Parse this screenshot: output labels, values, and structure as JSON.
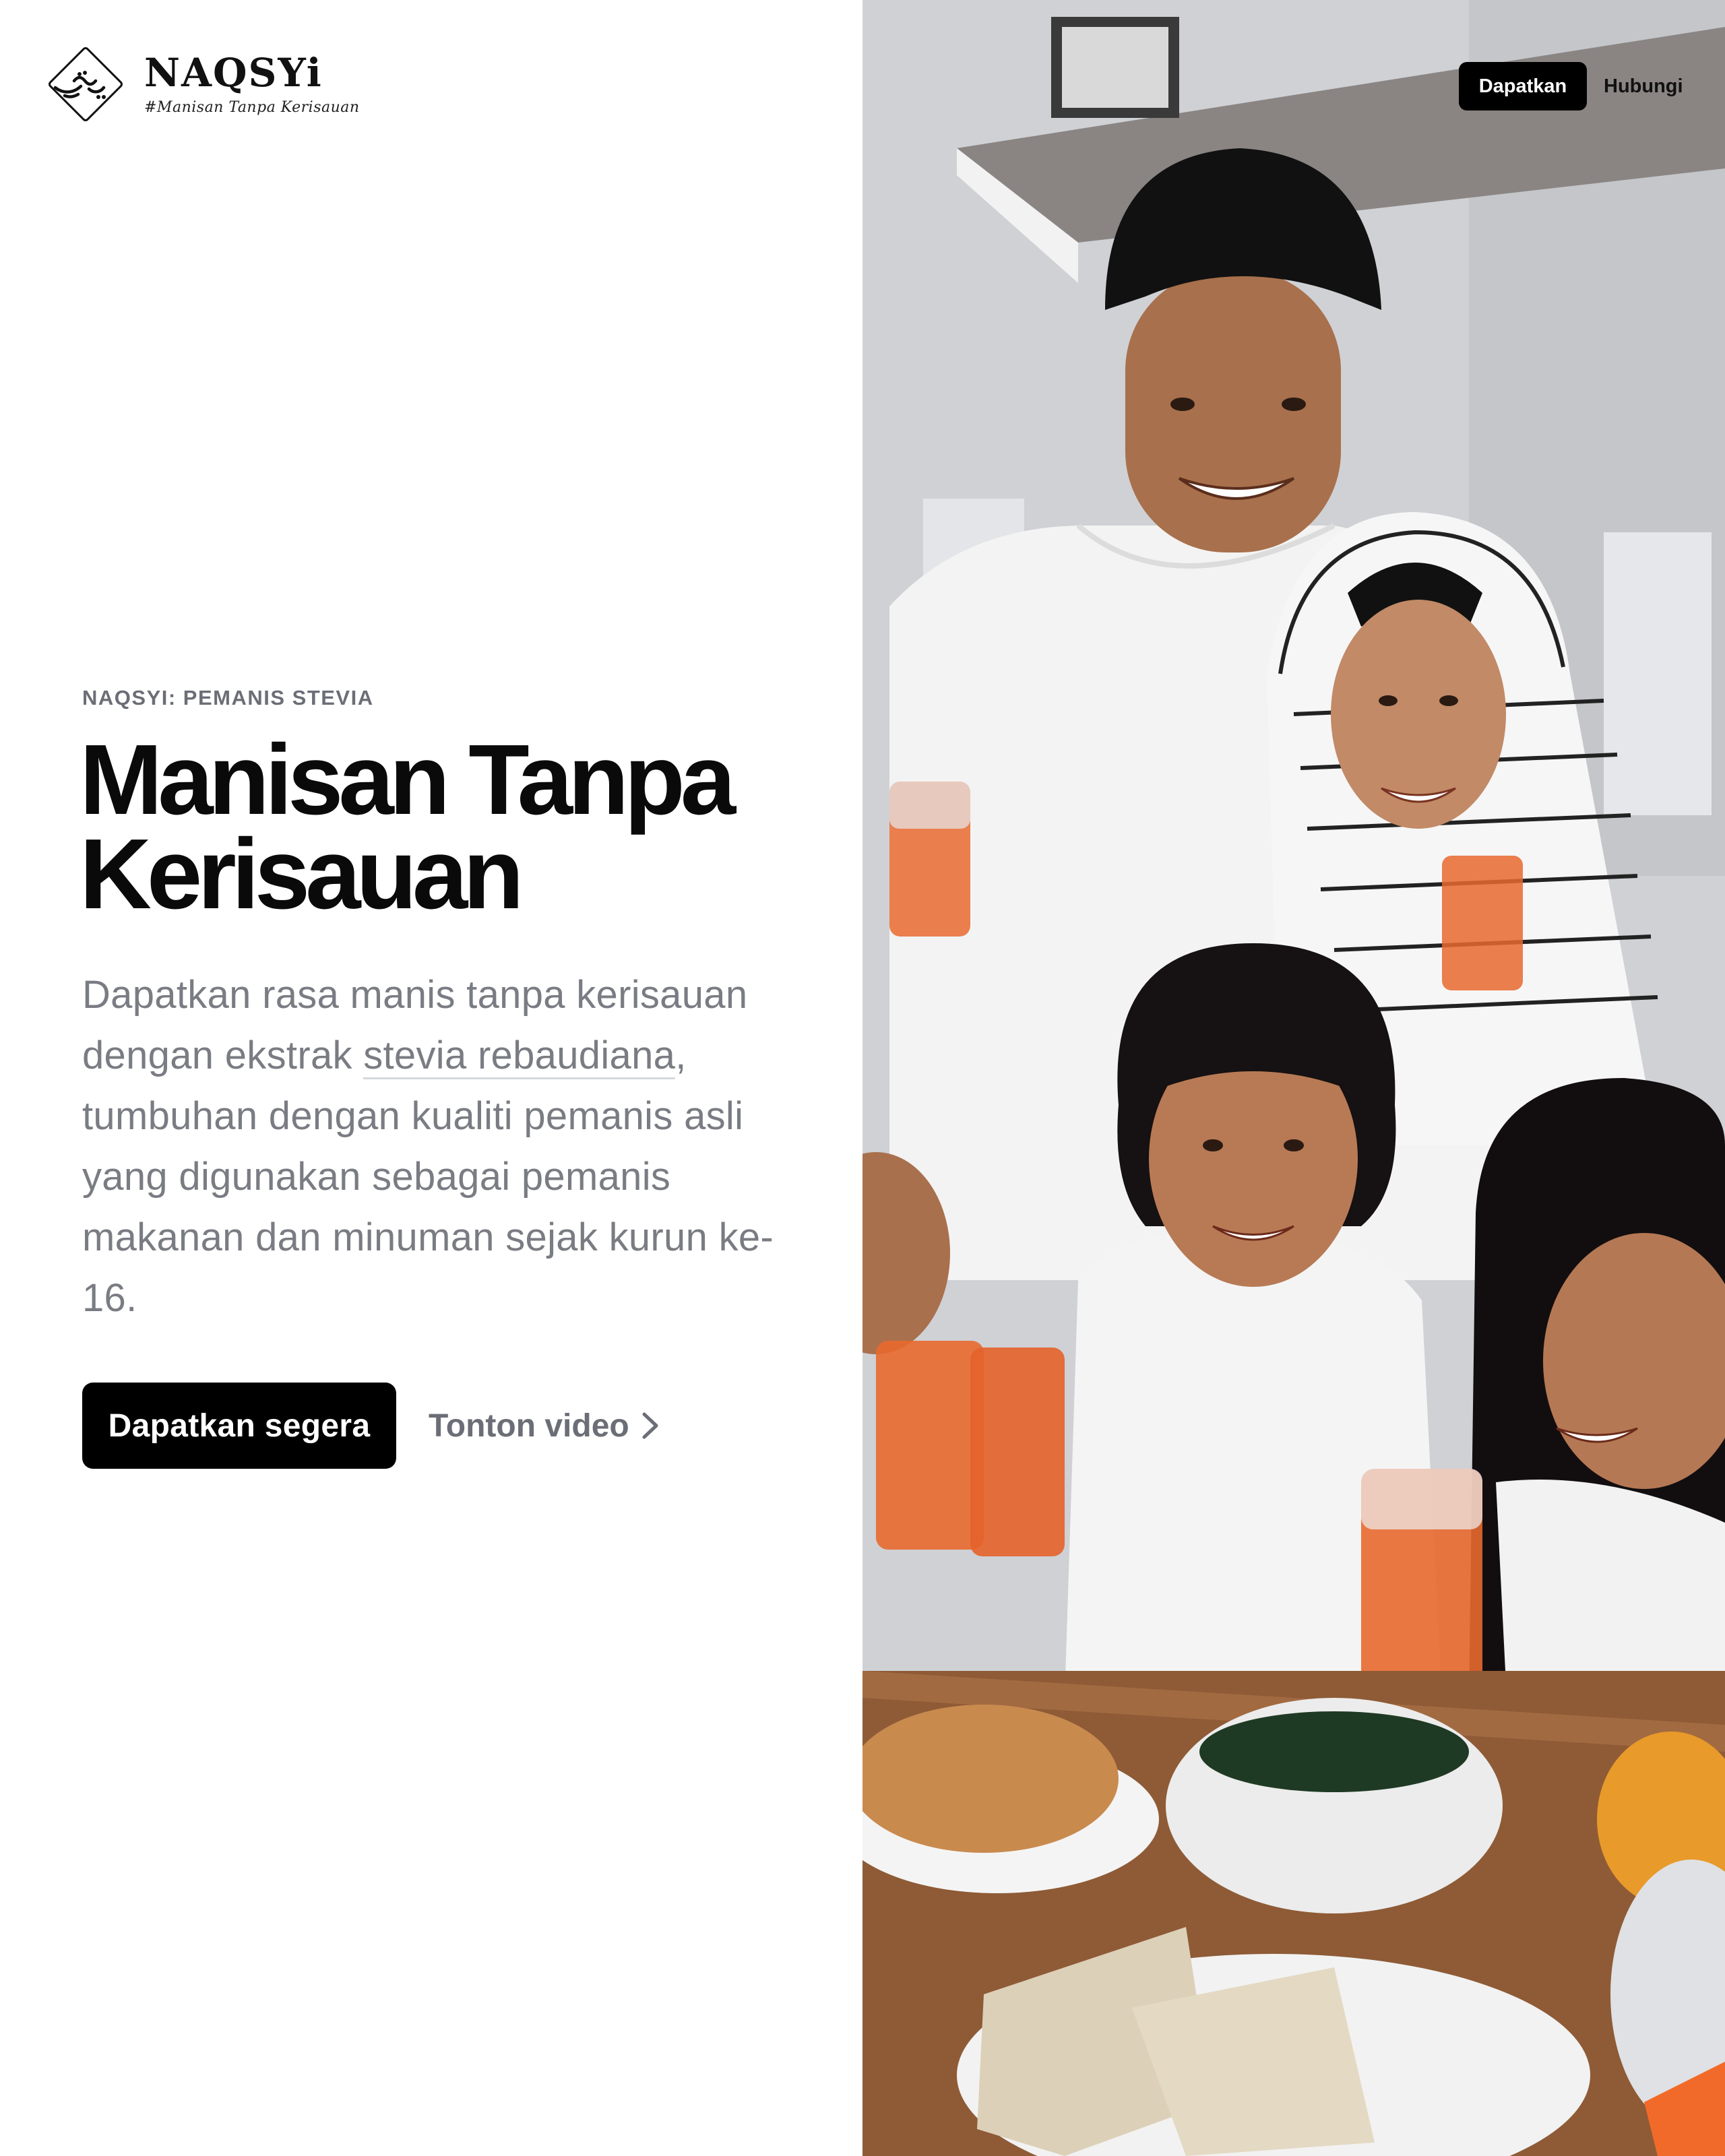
{
  "brand": {
    "name": "NAQSYi",
    "tagline": "#Manisan Tanpa Kerisauan"
  },
  "nav": {
    "primary_label": "Dapatkan",
    "secondary_label": "Hubungi"
  },
  "hero": {
    "eyebrow": "NAQSYI: PEMANIS STEVIA",
    "title_line1": "Manisan Tanpa",
    "title_line2": "Kerisauan",
    "lede_before": "Dapatkan rasa manis tanpa kerisauan dengan ekstrak ",
    "lede_link": "stevia rebaudiana",
    "lede_after": ", tumbuhan dengan kualiti pemanis asli yang digunakan sebagai pemanis makanan dan minuman sejak kurun ke-16.",
    "cta_label": "Dapatkan segera",
    "video_label": "Tonton video"
  },
  "image": {
    "subject": "family-iftar-photo"
  },
  "colors": {
    "accent": "#000000",
    "muted_text": "#7a7c83",
    "eyebrow_text": "#6b6e76",
    "drink": "#e8692f"
  }
}
